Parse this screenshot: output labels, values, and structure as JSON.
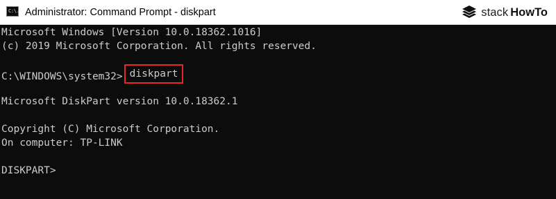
{
  "window": {
    "title": "Administrator: Command Prompt - diskpart",
    "app_icon_text": "C:\\."
  },
  "brand": {
    "logo_icon": "stack-layers-icon",
    "name_part1": "stack",
    "name_part2": "HowTo"
  },
  "console": {
    "lines": [
      "Microsoft Windows [Version 10.0.18362.1016]",
      "(c) 2019 Microsoft Corporation. All rights reserved.",
      "",
      "",
      "",
      "Microsoft DiskPart version 10.0.18362.1",
      "",
      "Copyright (C) Microsoft Corporation.",
      "On computer: TP-LINK",
      "",
      "DISKPART>"
    ],
    "prompt": "C:\\WINDOWS\\system32>",
    "command": "diskpart",
    "highlight_color": "#e8262c",
    "background_color": "#0c0c0c",
    "text_color": "#cccccc"
  }
}
